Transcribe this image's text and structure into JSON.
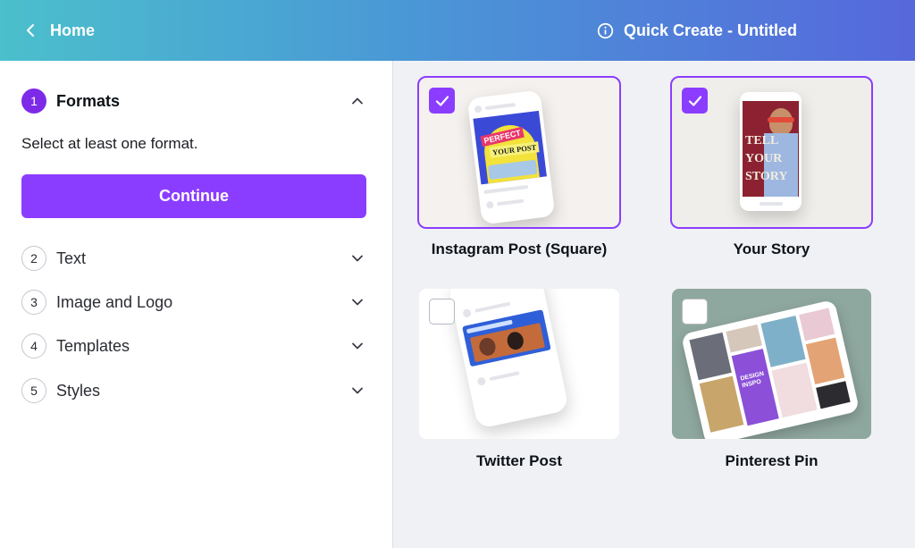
{
  "header": {
    "home_label": "Home",
    "title": "Quick Create - Untitled"
  },
  "sidebar": {
    "steps": [
      {
        "number": "1",
        "label": "Formats",
        "expanded": true
      },
      {
        "number": "2",
        "label": "Text",
        "expanded": false
      },
      {
        "number": "3",
        "label": "Image and Logo",
        "expanded": false
      },
      {
        "number": "4",
        "label": "Templates",
        "expanded": false
      },
      {
        "number": "5",
        "label": "Styles",
        "expanded": false
      }
    ],
    "helper_text": "Select at least one format.",
    "continue_label": "Continue"
  },
  "formats": [
    {
      "label": "Instagram Post (Square)",
      "selected": true,
      "artwork_text": [
        "PERFECT",
        "YOUR POST"
      ]
    },
    {
      "label": "Your Story",
      "selected": true,
      "artwork_text": [
        "TELL",
        "YOUR",
        "STORY"
      ]
    },
    {
      "label": "Twitter Post",
      "selected": false
    },
    {
      "label": "Pinterest Pin",
      "selected": false,
      "artwork_text": [
        "DESIGN",
        "INSPO"
      ]
    }
  ],
  "colors": {
    "accent": "#8b3dff",
    "header_start": "#4bbfcc",
    "header_end": "#5668dc"
  },
  "icons": {
    "back": "chevron-left-icon",
    "info": "info-icon",
    "expand": "chevron-down-icon",
    "collapse": "chevron-up-icon",
    "check": "checkmark-icon"
  }
}
